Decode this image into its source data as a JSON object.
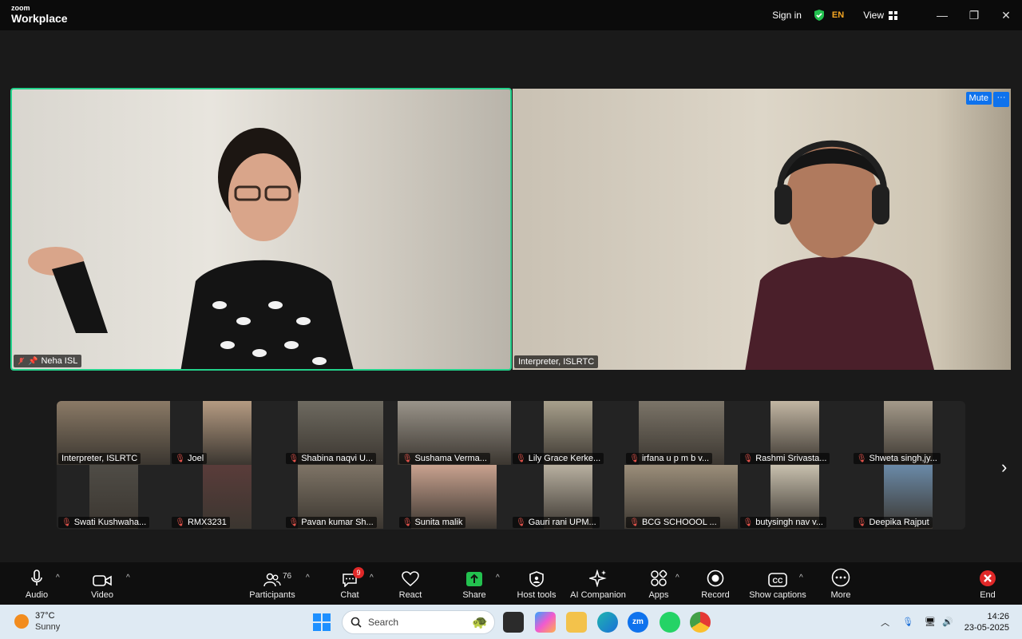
{
  "titlebar": {
    "brand_small": "zoom",
    "brand_big": "Workplace",
    "signin": "Sign in",
    "lang": "EN",
    "view": "View"
  },
  "videos": {
    "main_left": {
      "name": "Neha ISL"
    },
    "main_right": {
      "name": "Interpreter, ISLRTC",
      "mute_label": "Mute",
      "more_label": "···"
    }
  },
  "gallery": {
    "tiles": [
      {
        "name": "Interpreter, ISLRTC"
      },
      {
        "name": "Joel"
      },
      {
        "name": "Shabina naqvi U..."
      },
      {
        "name": "Sushama Verma..."
      },
      {
        "name": "Lily Grace Kerke..."
      },
      {
        "name": "irfana u p m b v..."
      },
      {
        "name": "Rashmi Srivasta..."
      },
      {
        "name": "Shweta singh,jy..."
      },
      {
        "name": "Swati Kushwaha..."
      },
      {
        "name": "RMX3231"
      },
      {
        "name": "Pavan kumar Sh..."
      },
      {
        "name": "Sunita malik"
      },
      {
        "name": "Gauri rani UPM..."
      },
      {
        "name": "BCG SCHOOOL ..."
      },
      {
        "name": "butysingh nav v..."
      },
      {
        "name": "Deepika Rajput"
      }
    ]
  },
  "toolbar": {
    "audio": "Audio",
    "video": "Video",
    "participants": "Participants",
    "participants_count": "76",
    "chat": "Chat",
    "chat_badge": "9",
    "react": "React",
    "share": "Share",
    "host_tools": "Host tools",
    "ai_companion": "AI Companion",
    "apps": "Apps",
    "record": "Record",
    "captions": "Show captions",
    "more": "More",
    "end": "End"
  },
  "taskbar": {
    "temp": "37°C",
    "condition": "Sunny",
    "search_placeholder": "Search",
    "time": "14:26",
    "date": "23-05-2025"
  },
  "colors": {
    "active_speaker_border": "#23d18b",
    "accent_blue": "#0e72ed",
    "end_red": "#e02828"
  }
}
